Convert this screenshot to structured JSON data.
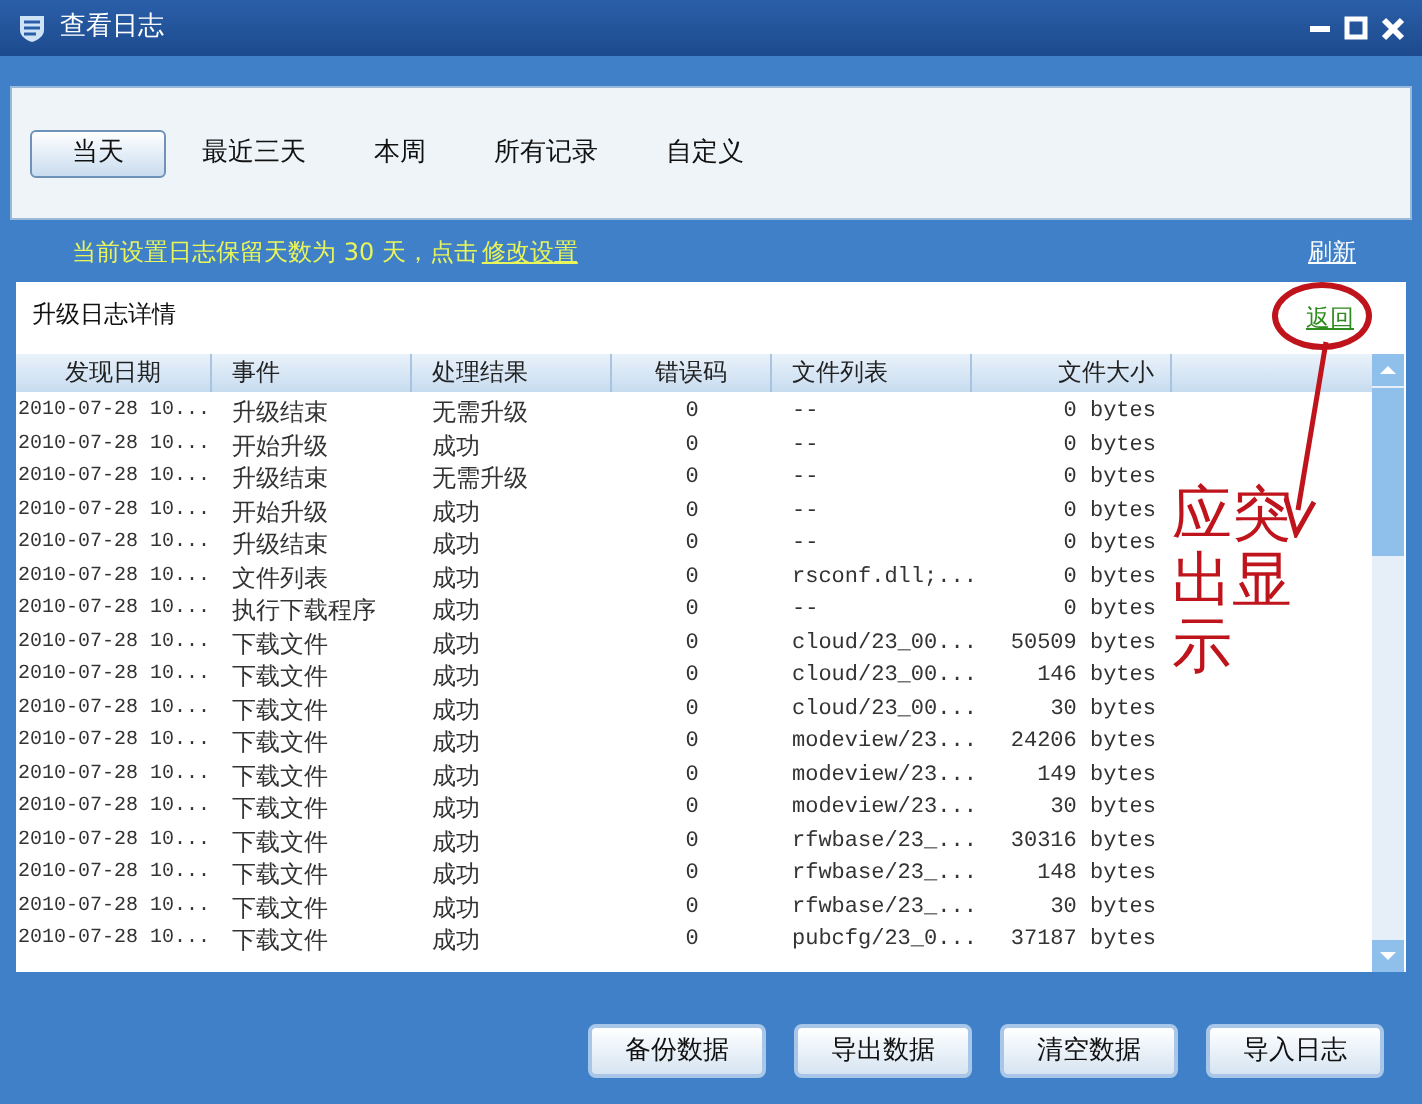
{
  "window": {
    "title": "查看日志"
  },
  "tabs": [
    {
      "label": "当天",
      "selected": true
    },
    {
      "label": "最近三天",
      "selected": false
    },
    {
      "label": "本周",
      "selected": false
    },
    {
      "label": "所有记录",
      "selected": false
    },
    {
      "label": "自定义",
      "selected": false
    }
  ],
  "retention_notice": {
    "text": "当前设置日志保留天数为 30 天，点击",
    "link": "修改设置"
  },
  "refresh_link": "刷新",
  "panel": {
    "title": "升级日志详情",
    "back_link": "返回"
  },
  "table": {
    "columns": [
      "发现日期",
      "事件",
      "处理结果",
      "错误码",
      "文件列表",
      "文件大小"
    ],
    "rows": [
      [
        "2010-07-28 10...",
        "升级结束",
        "无需升级",
        "0",
        "--",
        "0 bytes"
      ],
      [
        "2010-07-28 10...",
        "开始升级",
        "成功",
        "0",
        "--",
        "0 bytes"
      ],
      [
        "2010-07-28 10...",
        "升级结束",
        "无需升级",
        "0",
        "--",
        "0 bytes"
      ],
      [
        "2010-07-28 10...",
        "开始升级",
        "成功",
        "0",
        "--",
        "0 bytes"
      ],
      [
        "2010-07-28 10...",
        "升级结束",
        "成功",
        "0",
        "--",
        "0 bytes"
      ],
      [
        "2010-07-28 10...",
        "文件列表",
        "成功",
        "0",
        "rsconf.dll;...",
        "0 bytes"
      ],
      [
        "2010-07-28 10...",
        "执行下载程序",
        "成功",
        "0",
        "--",
        "0 bytes"
      ],
      [
        "2010-07-28 10...",
        "下载文件",
        "成功",
        "0",
        "cloud/23_00...",
        "50509 bytes"
      ],
      [
        "2010-07-28 10...",
        "下载文件",
        "成功",
        "0",
        "cloud/23_00...",
        "146 bytes"
      ],
      [
        "2010-07-28 10...",
        "下载文件",
        "成功",
        "0",
        "cloud/23_00...",
        "30 bytes"
      ],
      [
        "2010-07-28 10...",
        "下载文件",
        "成功",
        "0",
        "modeview/23...",
        "24206 bytes"
      ],
      [
        "2010-07-28 10...",
        "下载文件",
        "成功",
        "0",
        "modeview/23...",
        "149 bytes"
      ],
      [
        "2010-07-28 10...",
        "下载文件",
        "成功",
        "0",
        "modeview/23...",
        "30 bytes"
      ],
      [
        "2010-07-28 10...",
        "下载文件",
        "成功",
        "0",
        "rfwbase/23_...",
        "30316 bytes"
      ],
      [
        "2010-07-28 10...",
        "下载文件",
        "成功",
        "0",
        "rfwbase/23_...",
        "148 bytes"
      ],
      [
        "2010-07-28 10...",
        "下载文件",
        "成功",
        "0",
        "rfwbase/23_...",
        "30 bytes"
      ],
      [
        "2010-07-28 10...",
        "下载文件",
        "成功",
        "0",
        "pubcfg/23_0...",
        "37187 bytes"
      ]
    ]
  },
  "annotation": {
    "text": "应突出显示"
  },
  "buttons": [
    "备份数据",
    "导出数据",
    "清空数据",
    "导入日志"
  ]
}
